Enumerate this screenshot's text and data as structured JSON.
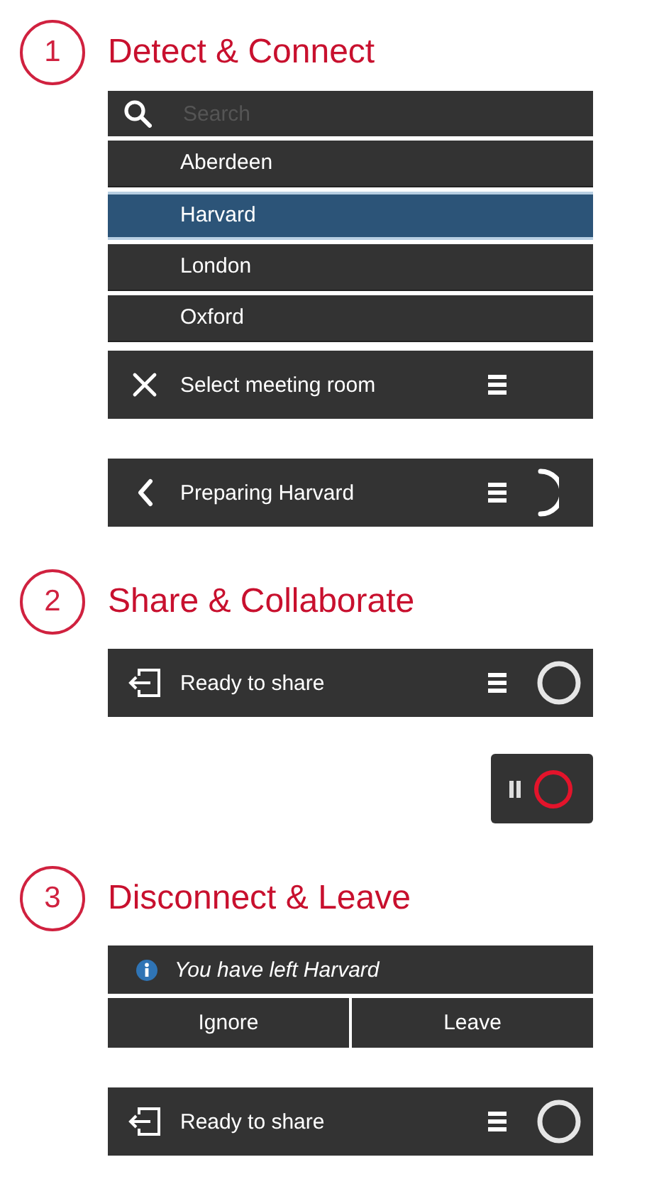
{
  "sections": [
    {
      "number": "1",
      "title": "Detect & Connect",
      "widgets": [
        {
          "kind": "search",
          "placeholder": "Search"
        },
        {
          "kind": "list",
          "items": [
            {
              "label": "Aberdeen",
              "selected": false
            },
            {
              "label": "Harvard",
              "selected": true
            },
            {
              "label": "London",
              "selected": false
            },
            {
              "label": "Oxford",
              "selected": false
            }
          ]
        },
        {
          "kind": "dismiss-bar",
          "label": "Select meeting room",
          "menu": true
        },
        {
          "kind": "back-bar",
          "label": "Preparing Harvard",
          "menu": true,
          "busy": true
        }
      ]
    },
    {
      "number": "2",
      "title": "Share & Collaborate",
      "widgets": [
        {
          "kind": "share-bar",
          "label": "Ready to share",
          "menu": true,
          "ring": true
        },
        {
          "kind": "recording-control",
          "recording": true
        }
      ]
    },
    {
      "number": "3",
      "title": "Disconnect & Leave",
      "widgets": [
        {
          "kind": "notice",
          "message": "You have left Harvard",
          "buttons": [
            "Ignore",
            "Leave"
          ]
        },
        {
          "kind": "share-bar",
          "label": "Ready to share",
          "menu": true,
          "ring": true
        }
      ]
    }
  ]
}
